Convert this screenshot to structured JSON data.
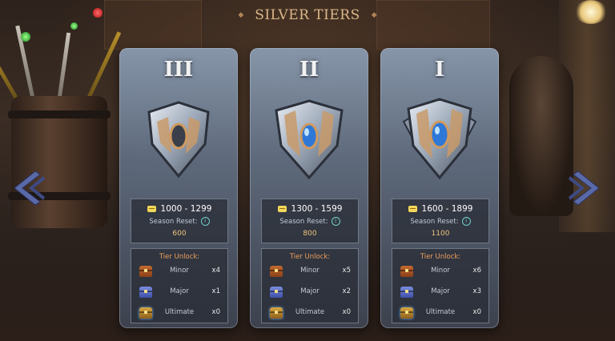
{
  "header": {
    "title": "SILVER TIERS"
  },
  "labels": {
    "season_reset": "Season Reset:",
    "tier_unlock": "Tier Unlock:"
  },
  "rewards": [
    "Minor",
    "Major",
    "Ultimate"
  ],
  "colors": {
    "title": "#dcb889",
    "reset_value": "#f0c27a",
    "unlock_title": "#f0a05c",
    "nav_arrow": "#5a6aa8"
  },
  "icons": {
    "coin": "rank-point-coin-icon",
    "info": "info-icon",
    "nav_left": "chevron-left-icon",
    "nav_right": "chevron-right-icon"
  },
  "cards": [
    {
      "numeral": "III",
      "range": "1000 - 1299",
      "reset_value": "600",
      "counts": [
        "x4",
        "x1",
        "x0"
      ]
    },
    {
      "numeral": "II",
      "range": "1300 - 1599",
      "reset_value": "800",
      "counts": [
        "x5",
        "x2",
        "x0"
      ]
    },
    {
      "numeral": "I",
      "range": "1600 - 1899",
      "reset_value": "1100",
      "counts": [
        "x6",
        "x3",
        "x0"
      ]
    }
  ],
  "info_glyph": "i"
}
